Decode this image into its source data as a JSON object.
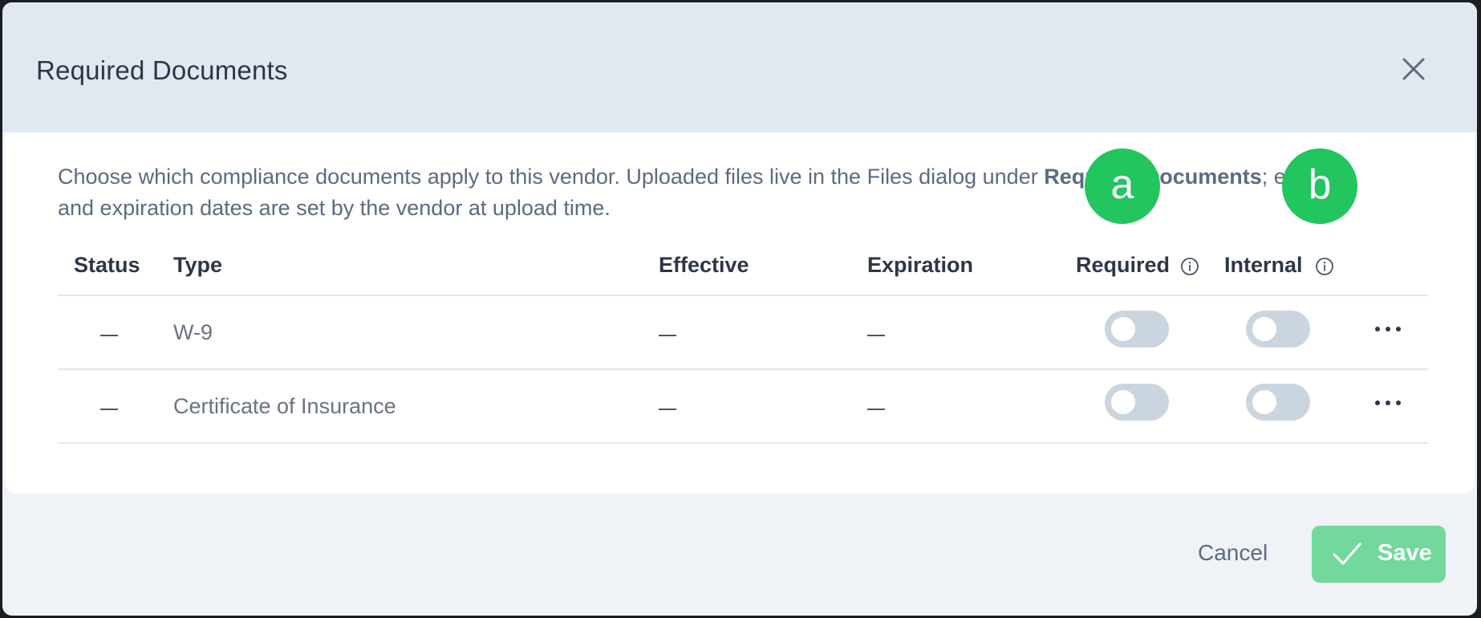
{
  "dialog": {
    "title": "Required Documents",
    "description_part1": "Choose which compliance documents apply to this vendor. Uploaded files live in the Files dialog under ",
    "description_bold": "Required Documents",
    "description_part2": "; effective and expiration dates are set by the vendor at upload time."
  },
  "table": {
    "headers": {
      "status": "Status",
      "type": "Type",
      "effective": "Effective",
      "expiration": "Expiration",
      "required": "Required",
      "internal": "Internal"
    },
    "rows": [
      {
        "status": "—",
        "type": "W-9",
        "effective": "—",
        "expiration": "—",
        "required": false,
        "internal": false
      },
      {
        "status": "—",
        "type": "Certificate of Insurance",
        "effective": "—",
        "expiration": "—",
        "required": false,
        "internal": false
      }
    ]
  },
  "markers": [
    "a",
    "b"
  ],
  "footer": {
    "cancel_label": "Cancel",
    "save_label": "Save"
  },
  "colors": {
    "header_bg": "#e1e8f0",
    "body_bg": "#ffffff",
    "footer_bg": "#eff3f8",
    "toggle_off": "#cbd5e0",
    "save_button": "#72d89b",
    "marker": "#22c55e"
  },
  "icons": {
    "close": "close-icon",
    "info": "info-icon",
    "more": "more-horizontal-icon",
    "check": "check-icon"
  }
}
